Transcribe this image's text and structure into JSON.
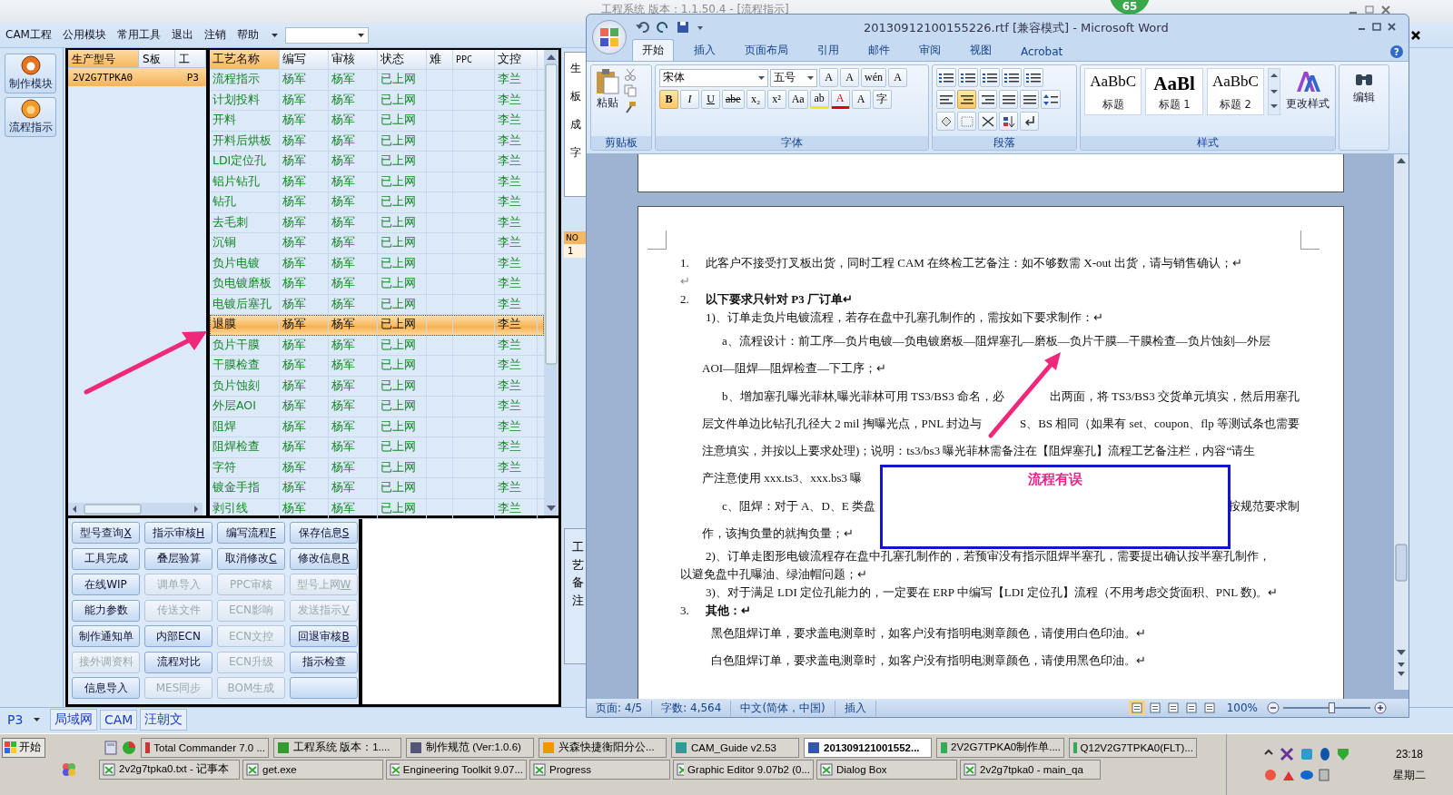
{
  "cam_window": {
    "title": "工程系统  版本：1.1.50.4 - [流程指示]",
    "menu": [
      "CAM工程",
      "公用模块",
      "常用工具",
      "退出",
      "注销",
      "帮助"
    ],
    "sidebar": [
      "制作模块",
      "流程指示"
    ],
    "model_table": {
      "columns": [
        "生产型号",
        "S板",
        "工"
      ],
      "rows": [
        {
          "model": "2V2G7TPKA0",
          "factory": "P3",
          "selected": true
        }
      ]
    },
    "process_table": {
      "columns": [
        "工艺名称",
        "编写",
        "审核",
        "状态",
        "难",
        "PPC",
        "文控"
      ],
      "rows": [
        {
          "name": "流程指示",
          "writer": "杨军",
          "reviewer": "杨军",
          "status": "已上网",
          "control": "李兰",
          "selected": false
        },
        {
          "name": "计划投料",
          "writer": "杨军",
          "reviewer": "杨军",
          "status": "已上网",
          "control": "李兰",
          "selected": false
        },
        {
          "name": "开料",
          "writer": "杨军",
          "reviewer": "杨军",
          "status": "已上网",
          "control": "李兰",
          "selected": false
        },
        {
          "name": "开料后烘板",
          "writer": "杨军",
          "reviewer": "杨军",
          "status": "已上网",
          "control": "李兰",
          "selected": false
        },
        {
          "name": "LDI定位孔",
          "writer": "杨军",
          "reviewer": "杨军",
          "status": "已上网",
          "control": "李兰",
          "selected": false
        },
        {
          "name": "铝片钻孔",
          "writer": "杨军",
          "reviewer": "杨军",
          "status": "已上网",
          "control": "李兰",
          "selected": false
        },
        {
          "name": "钻孔",
          "writer": "杨军",
          "reviewer": "杨军",
          "status": "已上网",
          "control": "李兰",
          "selected": false
        },
        {
          "name": "去毛刺",
          "writer": "杨军",
          "reviewer": "杨军",
          "status": "已上网",
          "control": "李兰",
          "selected": false
        },
        {
          "name": "沉铜",
          "writer": "杨军",
          "reviewer": "杨军",
          "status": "已上网",
          "control": "李兰",
          "selected": false
        },
        {
          "name": "负片电镀",
          "writer": "杨军",
          "reviewer": "杨军",
          "status": "已上网",
          "control": "李兰",
          "selected": false
        },
        {
          "name": "负电镀磨板",
          "writer": "杨军",
          "reviewer": "杨军",
          "status": "已上网",
          "control": "李兰",
          "selected": false
        },
        {
          "name": "电镀后塞孔",
          "writer": "杨军",
          "reviewer": "杨军",
          "status": "已上网",
          "control": "李兰",
          "selected": false
        },
        {
          "name": "退膜",
          "writer": "杨军",
          "reviewer": "杨军",
          "status": "已上网",
          "control": "李兰",
          "selected": true
        },
        {
          "name": "负片干膜",
          "writer": "杨军",
          "reviewer": "杨军",
          "status": "已上网",
          "control": "李兰",
          "selected": false
        },
        {
          "name": "干膜检查",
          "writer": "杨军",
          "reviewer": "杨军",
          "status": "已上网",
          "control": "李兰",
          "selected": false
        },
        {
          "name": "负片蚀刻",
          "writer": "杨军",
          "reviewer": "杨军",
          "status": "已上网",
          "control": "李兰",
          "selected": false
        },
        {
          "name": "外层AOI",
          "writer": "杨军",
          "reviewer": "杨军",
          "status": "已上网",
          "control": "李兰",
          "selected": false
        },
        {
          "name": "阻焊",
          "writer": "杨军",
          "reviewer": "杨军",
          "status": "已上网",
          "control": "李兰",
          "selected": false
        },
        {
          "name": "阻焊检查",
          "writer": "杨军",
          "reviewer": "杨军",
          "status": "已上网",
          "control": "李兰",
          "selected": false
        },
        {
          "name": "字符",
          "writer": "杨军",
          "reviewer": "杨军",
          "status": "已上网",
          "control": "李兰",
          "selected": false
        },
        {
          "name": "镀金手指",
          "writer": "杨军",
          "reviewer": "杨军",
          "status": "已上网",
          "control": "李兰",
          "selected": false
        },
        {
          "name": "剥引线",
          "writer": "杨军",
          "reviewer": "杨军",
          "status": "已上网",
          "control": "李兰",
          "selected": false
        }
      ]
    },
    "buttons": [
      {
        "kind": "command",
        "label": "型号查询",
        "shortcut": "X",
        "disabled": false
      },
      {
        "kind": "command",
        "label": "指示审核",
        "shortcut": "H",
        "disabled": false
      },
      {
        "kind": "command",
        "label": "编写流程",
        "shortcut": "F",
        "disabled": false
      },
      {
        "kind": "command",
        "label": "保存信息",
        "shortcut": "S",
        "disabled": false
      },
      {
        "kind": "command",
        "label": "工具完成",
        "disabled": false
      },
      {
        "kind": "command",
        "label": "叠层验算",
        "disabled": false
      },
      {
        "kind": "command",
        "label": "取消修改",
        "shortcut": "C",
        "disabled": false
      },
      {
        "kind": "command",
        "label": "修改信息",
        "shortcut": "R",
        "disabled": false
      },
      {
        "kind": "command",
        "label": "在线WIP",
        "disabled": false
      },
      {
        "kind": "command",
        "label": "调单导入",
        "disabled": true
      },
      {
        "kind": "command",
        "label": "PPC审核",
        "disabled": true
      },
      {
        "kind": "command",
        "label": "型号上网",
        "shortcut": "W",
        "disabled": true
      },
      {
        "kind": "command",
        "label": "能力参数",
        "disabled": false
      },
      {
        "kind": "command",
        "label": "传送文件",
        "disabled": true
      },
      {
        "kind": "command",
        "label": "ECN影响",
        "disabled": true
      },
      {
        "kind": "command",
        "label": "发送指示",
        "shortcut": "V",
        "disabled": true
      },
      {
        "kind": "command",
        "label": "制作通知单",
        "disabled": false
      },
      {
        "kind": "command",
        "label": "内部ECN",
        "disabled": false
      },
      {
        "kind": "command",
        "label": "ECN文控",
        "disabled": true
      },
      {
        "kind": "command",
        "label": "回退审核",
        "shortcut": "B",
        "disabled": false
      },
      {
        "kind": "command",
        "label": "接外调资料",
        "disabled": true
      },
      {
        "kind": "command",
        "label": "流程对比",
        "disabled": false
      },
      {
        "kind": "command",
        "label": "ECN升级",
        "disabled": true
      },
      {
        "kind": "command",
        "label": "指示检查",
        "disabled": false
      },
      {
        "kind": "command",
        "label": "信息导入",
        "disabled": false
      },
      {
        "kind": "command",
        "label": "MES同步",
        "disabled": true
      },
      {
        "kind": "command",
        "label": "BOM生成",
        "disabled": true
      },
      {
        "kind": "blank",
        "disabled": false
      }
    ],
    "side_panel": {
      "labels": [
        "生",
        "板",
        "成",
        "字"
      ],
      "no_column": "NO",
      "no_cell": "1",
      "note_label": "工艺备注"
    },
    "status_tabs": {
      "dropdown": "P3",
      "tabs": [
        "局域网",
        "CAM",
        "汪朝文"
      ]
    }
  },
  "badge": "65",
  "word": {
    "title": "20130912100155226.rtf [兼容模式] - Microsoft Word",
    "tabs": [
      {
        "label": "开始",
        "selected": true
      },
      {
        "label": "插入",
        "selected": false
      },
      {
        "label": "页面布局",
        "selected": false
      },
      {
        "label": "引用",
        "selected": false
      },
      {
        "label": "邮件",
        "selected": false
      },
      {
        "label": "审阅",
        "selected": false
      },
      {
        "label": "视图",
        "selected": false
      },
      {
        "label": "Acrobat",
        "selected": false
      }
    ],
    "help_button": "?",
    "ribbon": {
      "paste": "粘贴",
      "font": "宋体",
      "size": "五号",
      "font_tools": [
        "A",
        "A",
        "wén",
        "A"
      ],
      "format_buttons": [
        {
          "label": "B",
          "selected": true
        },
        {
          "label": "I",
          "selected": false
        },
        {
          "label": "U",
          "selected": false
        },
        {
          "label": "abe",
          "selected": false
        },
        {
          "label": "x₂",
          "selected": false
        },
        {
          "label": "x²",
          "selected": false
        },
        {
          "label": "Aa",
          "selected": false
        },
        {
          "label": "ab",
          "selected": false
        },
        {
          "label": "A",
          "selected": false
        },
        {
          "label": "A",
          "selected": false
        },
        {
          "label": "字",
          "selected": false
        }
      ],
      "align_buttons": [
        {
          "selected": false
        },
        {
          "selected": true
        },
        {
          "selected": false
        },
        {
          "selected": false
        },
        {
          "selected": false
        }
      ],
      "styles": [
        {
          "sample": "AaBbC",
          "name": "标题"
        },
        {
          "sample": "AaBl",
          "name": "标题 1"
        },
        {
          "sample": "AaBbC",
          "name": "标题 2"
        }
      ],
      "change_styles": "更改样式",
      "edit": "编辑",
      "groups": [
        "剪贴板",
        "字体",
        "段落",
        "样式"
      ]
    },
    "document": {
      "lines": [
        {
          "kind": "numbered",
          "number": "1.",
          "text": "此客户不接受打叉板出货，同时工程 CAM 在终检工艺备注：如不够数需 X-out 出货，请与销售确认；↵"
        },
        {
          "kind": "blank",
          "text": "↵"
        },
        {
          "kind": "numbered",
          "number": "2.",
          "text": "以下要求只针对 P3 厂订单↵",
          "bold": true
        },
        {
          "kind": "step",
          "text": "1)、订单走负片电镀流程，若存在盘中孔塞孔制作的，需按如下要求制作：↵"
        },
        {
          "kind": "detail",
          "text": "a、流程设计：前工序—负片电镀—负电镀磨板—阻焊塞孔—磨板—负片干膜—干膜检查—负片蚀刻—外层"
        },
        {
          "kind": "wrap",
          "text": "AOI—阻焊—阻焊检查—下工序；↵"
        },
        {
          "kind": "detail",
          "text": "b、增加塞孔曝光菲林,曝光菲林可用 TS3/BS3 命名，必",
          "tail": "出两面，将 TS3/BS3 交货单元填实，然后用塞孔"
        },
        {
          "kind": "wrap",
          "text": "层文件单边比钻孔孔径大 2 mil 掏曝光点，PNL 封边与",
          "tail": "S、BS 相同（如果有 set、coupon、flp 等测试条也需要"
        },
        {
          "kind": "wrap",
          "text": "注意填实，并按以上要求处理)；说明：ts3/bs3 曝光菲林需备注在【阻焊塞孔】流程工艺备注栏，内容“请生"
        },
        {
          "kind": "wrap",
          "text": "产注意使用 xxx.ts3、xxx.bs3 曝"
        },
        {
          "kind": "detail",
          "text": "c、阻焊：对于 A、D、E 类盘",
          "tail": "按规范要求制"
        },
        {
          "kind": "wrap",
          "text": "作，该掏负量的就掏负量；↵"
        },
        {
          "kind": "step",
          "text": "2)、订单走图形电镀流程存在盘中孔塞孔制作的，若预审没有指示阻焊半塞孔，需要提出确认按半塞孔制作，"
        },
        {
          "kind": "flush",
          "text": "以避免盘中孔曝油、绿油帽问题；↵"
        },
        {
          "kind": "step",
          "text": "3)、对于满足 LDI 定位孔能力的，一定要在 ERP 中编写【LDI 定位孔】流程（不用考虑交货面积、PNL 数)。↵"
        },
        {
          "kind": "numbered",
          "number": "3.",
          "text": "其他：↵",
          "bold": true
        },
        {
          "kind": "note",
          "text": "黑色阻焊订单，要求盖电测章时，如客户没有指明电测章颜色，请使用白色印油。↵"
        },
        {
          "kind": "note",
          "text": "白色阻焊订单，要求盖电测章时，如客户没有指明电测章颜色，请使用黑色印油。↵"
        }
      ],
      "annotation": "流程有误"
    },
    "status": {
      "page": "页面: 4/5",
      "words": "字数: 4,564",
      "language": "中文(简体，中国)",
      "mode": "插入",
      "zoom": "100%"
    },
    "view_buttons": [
      {
        "selected": true
      },
      {
        "selected": false
      },
      {
        "selected": false
      },
      {
        "selected": false
      },
      {
        "selected": false
      }
    ],
    "zoom_slider": {
      "level": 0.55
    }
  },
  "taskbar": {
    "start": "开始",
    "row1": [
      {
        "label": "Total Commander 7.0 ...",
        "selected": false
      },
      {
        "label": "工程系统  版本：1....",
        "selected": false
      },
      {
        "label": "制作规范 (Ver:1.0.6)",
        "selected": false
      },
      {
        "label": "兴森快捷衡阳分公...",
        "selected": false
      },
      {
        "label": "CAM_Guide v2.53",
        "selected": false
      },
      {
        "label": "201309121001552...",
        "selected": true
      },
      {
        "label": "2V2G7TPKA0制作单....",
        "selected": false
      },
      {
        "label": "Q12V2G7TPKA0(FLT)...",
        "selected": false
      }
    ],
    "row2": [
      {
        "label": "2v2g7tpka0.txt - 记事本",
        "selected": false
      },
      {
        "label": "get.exe",
        "selected": false
      },
      {
        "label": "Engineering Toolkit 9.07...",
        "selected": false
      },
      {
        "label": "Progress",
        "selected": false
      },
      {
        "label": "Graphic Editor 9.07b2 (0...",
        "selected": false
      },
      {
        "label": "Dialog Box",
        "selected": false
      },
      {
        "label": "2v2g7tpka0 - main_qa",
        "selected": false
      }
    ],
    "clock": "23:18",
    "day": "星期二"
  }
}
